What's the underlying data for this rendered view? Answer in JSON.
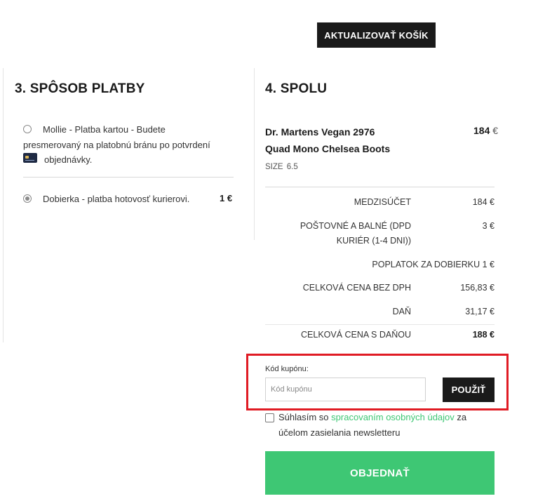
{
  "cart": {
    "update_button": "AKTUALIZOVAŤ KOŠÍK"
  },
  "payment": {
    "title": "3. SPÔSOB PLATBY",
    "options": [
      {
        "line1": "Mollie - Platba kartou - Budete",
        "line2": "presmerovaný na platobnú bránu po potvrdení",
        "line3": "objednávky.",
        "icon": "credit-card-icon",
        "selected": false
      },
      {
        "label": "Dobierka - platba hotovosť kurierovi.",
        "price": "1 €",
        "selected": true
      }
    ]
  },
  "summary": {
    "title": "4. SPOLU",
    "product": {
      "name_line1": "Dr. Martens Vegan 2976",
      "name_line2": "Quad Mono Chelsea Boots",
      "price": "184",
      "currency": "€",
      "size_label": "SIZE",
      "size_value": "6.5"
    },
    "rows": {
      "subtotal_label": "MEDZISÚČET",
      "subtotal_value": "184 €",
      "shipping_label_line1": "POŠTOVNÉ A BALNÉ (DPD",
      "shipping_label_line2": "KURIÉR (1-4 DNI))",
      "shipping_value": "3 €",
      "cod_fee": "POPLATOK ZA DOBIERKU 1 €",
      "net_label": "CELKOVÁ CENA BEZ DPH",
      "net_value": "156,83 €",
      "tax_label": "DAŇ",
      "tax_value": "31,17 €",
      "total_label": "CELKOVÁ CENA S DAŇOU",
      "total_value": "188 €"
    },
    "coupon": {
      "label": "Kód kupónu:",
      "placeholder": "Kód kupónu",
      "value": "",
      "apply_button": "POUŽIŤ"
    },
    "consent": {
      "before": "Súhlasím so",
      "link": "spracovaním osobných údajov",
      "after": "za",
      "line2": "účelom zasielania newsletteru",
      "checked": false
    },
    "order_button": "OBJEDNAŤ"
  },
  "colors": {
    "accent_green": "#3ec774",
    "dark_button": "#1a1a1a",
    "highlight_red": "#e01b24"
  }
}
